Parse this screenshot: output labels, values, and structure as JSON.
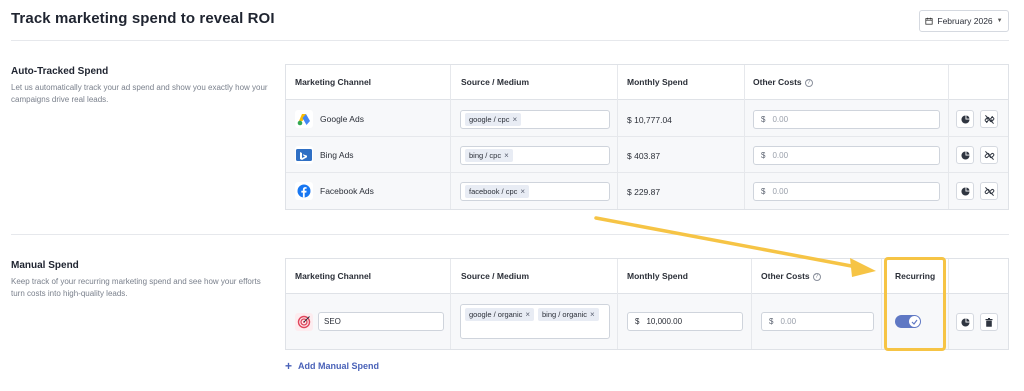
{
  "header": {
    "title": "Track marketing spend to reveal ROI",
    "month_label": "February 2026"
  },
  "auto": {
    "title": "Auto-Tracked Spend",
    "description": "Let us automatically track your ad spend and show you exactly how your campaigns drive real leads.",
    "columns": {
      "channel": "Marketing Channel",
      "source": "Source / Medium",
      "spend": "Monthly Spend",
      "other": "Other Costs"
    },
    "rows": [
      {
        "channel": "Google Ads",
        "icon": "google-ads-icon",
        "tags": [
          "google / cpc"
        ],
        "spend": "$ 10,777.04",
        "currency": "$",
        "other_placeholder": "0.00"
      },
      {
        "channel": "Bing Ads",
        "icon": "bing-ads-icon",
        "tags": [
          "bing / cpc"
        ],
        "spend": "$ 403.87",
        "currency": "$",
        "other_placeholder": "0.00"
      },
      {
        "channel": "Facebook Ads",
        "icon": "facebook-icon",
        "tags": [
          "facebook / cpc"
        ],
        "spend": "$ 229.87",
        "currency": "$",
        "other_placeholder": "0.00"
      }
    ]
  },
  "manual": {
    "title": "Manual Spend",
    "description": "Keep track of your recurring marketing spend and see how your efforts turn costs into high-quality leads.",
    "columns": {
      "channel": "Marketing Channel",
      "source": "Source / Medium",
      "spend": "Monthly Spend",
      "other": "Other Costs",
      "recurring": "Recurring"
    },
    "rows": [
      {
        "channel": "SEO",
        "icon": "target-icon",
        "tags": [
          "google / organic",
          "bing / organic"
        ],
        "currency": "$",
        "spend": "10,000.00",
        "other_placeholder": "0.00",
        "recurring": true
      }
    ],
    "add_label": "Add Manual Spend"
  },
  "colors": {
    "accent": "#4a62b8",
    "toggle_on": "#5f78c4",
    "annotation": "#f6c445"
  }
}
